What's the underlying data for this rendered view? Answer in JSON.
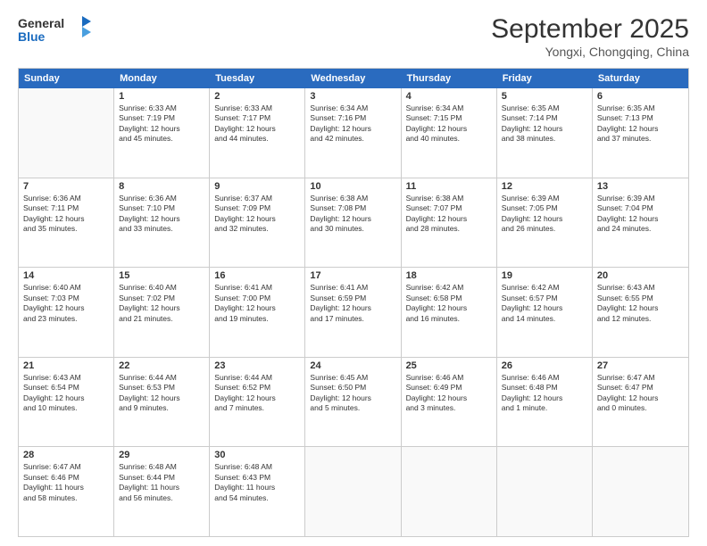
{
  "header": {
    "logo_general": "General",
    "logo_blue": "Blue",
    "month_title": "September 2025",
    "location": "Yongxi, Chongqing, China"
  },
  "weekdays": [
    "Sunday",
    "Monday",
    "Tuesday",
    "Wednesday",
    "Thursday",
    "Friday",
    "Saturday"
  ],
  "rows": [
    [
      {
        "day": "",
        "info": ""
      },
      {
        "day": "1",
        "info": "Sunrise: 6:33 AM\nSunset: 7:19 PM\nDaylight: 12 hours\nand 45 minutes."
      },
      {
        "day": "2",
        "info": "Sunrise: 6:33 AM\nSunset: 7:17 PM\nDaylight: 12 hours\nand 44 minutes."
      },
      {
        "day": "3",
        "info": "Sunrise: 6:34 AM\nSunset: 7:16 PM\nDaylight: 12 hours\nand 42 minutes."
      },
      {
        "day": "4",
        "info": "Sunrise: 6:34 AM\nSunset: 7:15 PM\nDaylight: 12 hours\nand 40 minutes."
      },
      {
        "day": "5",
        "info": "Sunrise: 6:35 AM\nSunset: 7:14 PM\nDaylight: 12 hours\nand 38 minutes."
      },
      {
        "day": "6",
        "info": "Sunrise: 6:35 AM\nSunset: 7:13 PM\nDaylight: 12 hours\nand 37 minutes."
      }
    ],
    [
      {
        "day": "7",
        "info": "Sunrise: 6:36 AM\nSunset: 7:11 PM\nDaylight: 12 hours\nand 35 minutes."
      },
      {
        "day": "8",
        "info": "Sunrise: 6:36 AM\nSunset: 7:10 PM\nDaylight: 12 hours\nand 33 minutes."
      },
      {
        "day": "9",
        "info": "Sunrise: 6:37 AM\nSunset: 7:09 PM\nDaylight: 12 hours\nand 32 minutes."
      },
      {
        "day": "10",
        "info": "Sunrise: 6:38 AM\nSunset: 7:08 PM\nDaylight: 12 hours\nand 30 minutes."
      },
      {
        "day": "11",
        "info": "Sunrise: 6:38 AM\nSunset: 7:07 PM\nDaylight: 12 hours\nand 28 minutes."
      },
      {
        "day": "12",
        "info": "Sunrise: 6:39 AM\nSunset: 7:05 PM\nDaylight: 12 hours\nand 26 minutes."
      },
      {
        "day": "13",
        "info": "Sunrise: 6:39 AM\nSunset: 7:04 PM\nDaylight: 12 hours\nand 24 minutes."
      }
    ],
    [
      {
        "day": "14",
        "info": "Sunrise: 6:40 AM\nSunset: 7:03 PM\nDaylight: 12 hours\nand 23 minutes."
      },
      {
        "day": "15",
        "info": "Sunrise: 6:40 AM\nSunset: 7:02 PM\nDaylight: 12 hours\nand 21 minutes."
      },
      {
        "day": "16",
        "info": "Sunrise: 6:41 AM\nSunset: 7:00 PM\nDaylight: 12 hours\nand 19 minutes."
      },
      {
        "day": "17",
        "info": "Sunrise: 6:41 AM\nSunset: 6:59 PM\nDaylight: 12 hours\nand 17 minutes."
      },
      {
        "day": "18",
        "info": "Sunrise: 6:42 AM\nSunset: 6:58 PM\nDaylight: 12 hours\nand 16 minutes."
      },
      {
        "day": "19",
        "info": "Sunrise: 6:42 AM\nSunset: 6:57 PM\nDaylight: 12 hours\nand 14 minutes."
      },
      {
        "day": "20",
        "info": "Sunrise: 6:43 AM\nSunset: 6:55 PM\nDaylight: 12 hours\nand 12 minutes."
      }
    ],
    [
      {
        "day": "21",
        "info": "Sunrise: 6:43 AM\nSunset: 6:54 PM\nDaylight: 12 hours\nand 10 minutes."
      },
      {
        "day": "22",
        "info": "Sunrise: 6:44 AM\nSunset: 6:53 PM\nDaylight: 12 hours\nand 9 minutes."
      },
      {
        "day": "23",
        "info": "Sunrise: 6:44 AM\nSunset: 6:52 PM\nDaylight: 12 hours\nand 7 minutes."
      },
      {
        "day": "24",
        "info": "Sunrise: 6:45 AM\nSunset: 6:50 PM\nDaylight: 12 hours\nand 5 minutes."
      },
      {
        "day": "25",
        "info": "Sunrise: 6:46 AM\nSunset: 6:49 PM\nDaylight: 12 hours\nand 3 minutes."
      },
      {
        "day": "26",
        "info": "Sunrise: 6:46 AM\nSunset: 6:48 PM\nDaylight: 12 hours\nand 1 minute."
      },
      {
        "day": "27",
        "info": "Sunrise: 6:47 AM\nSunset: 6:47 PM\nDaylight: 12 hours\nand 0 minutes."
      }
    ],
    [
      {
        "day": "28",
        "info": "Sunrise: 6:47 AM\nSunset: 6:46 PM\nDaylight: 11 hours\nand 58 minutes."
      },
      {
        "day": "29",
        "info": "Sunrise: 6:48 AM\nSunset: 6:44 PM\nDaylight: 11 hours\nand 56 minutes."
      },
      {
        "day": "30",
        "info": "Sunrise: 6:48 AM\nSunset: 6:43 PM\nDaylight: 11 hours\nand 54 minutes."
      },
      {
        "day": "",
        "info": ""
      },
      {
        "day": "",
        "info": ""
      },
      {
        "day": "",
        "info": ""
      },
      {
        "day": "",
        "info": ""
      }
    ]
  ]
}
